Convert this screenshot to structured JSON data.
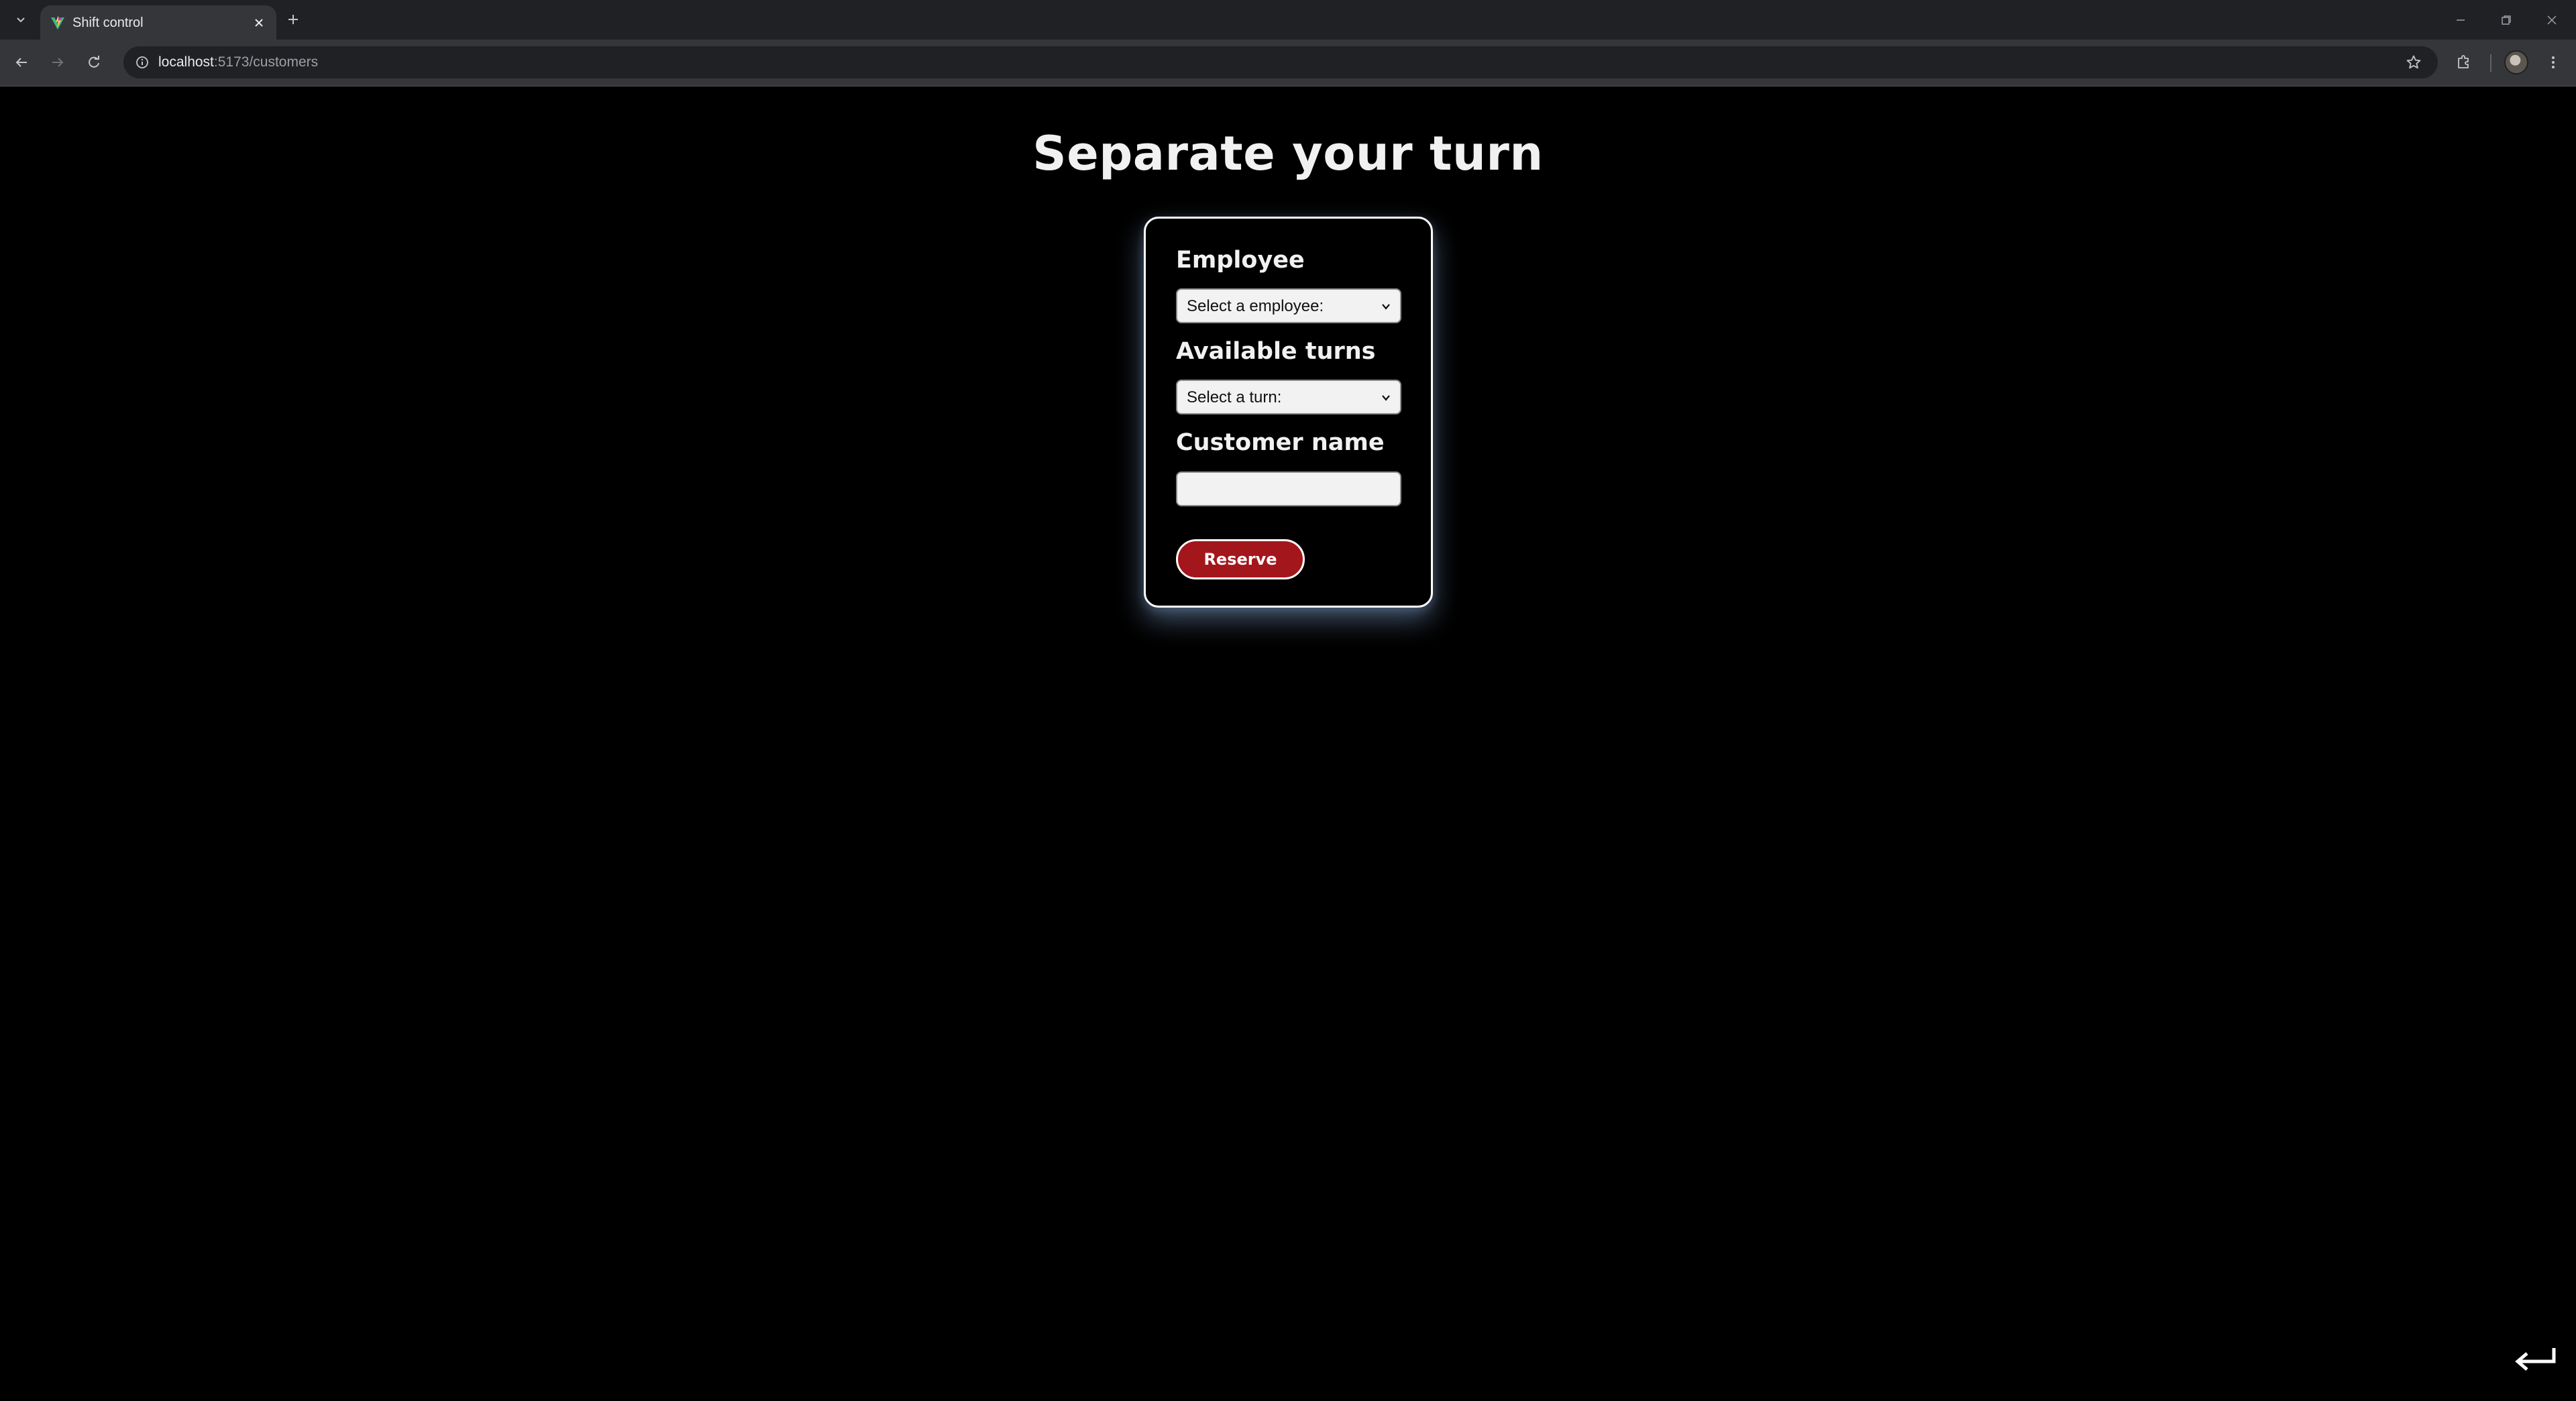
{
  "browser": {
    "tab_title": "Shift control",
    "url_host": "localhost",
    "url_path": ":5173/customers"
  },
  "page": {
    "title": "Separate your turn",
    "form": {
      "employee_label": "Employee",
      "employee_select_value": "Select a employee:",
      "turns_label": "Available turns",
      "turns_select_value": "Select a turn:",
      "customer_label": "Customer name",
      "customer_value": "",
      "reserve_label": "Reserve"
    }
  },
  "colors": {
    "background": "#000000",
    "button": "#a3161c",
    "card_border": "#ffffff"
  },
  "icons": [
    "tab-list-icon",
    "favicon-icon",
    "close-icon",
    "plus-icon",
    "minimize-icon",
    "restore-icon",
    "window-close-icon",
    "back-icon",
    "forward-icon",
    "reload-icon",
    "site-info-icon",
    "star-icon",
    "extensions-icon",
    "more-icon",
    "chevron-down-icon",
    "enter-icon"
  ]
}
